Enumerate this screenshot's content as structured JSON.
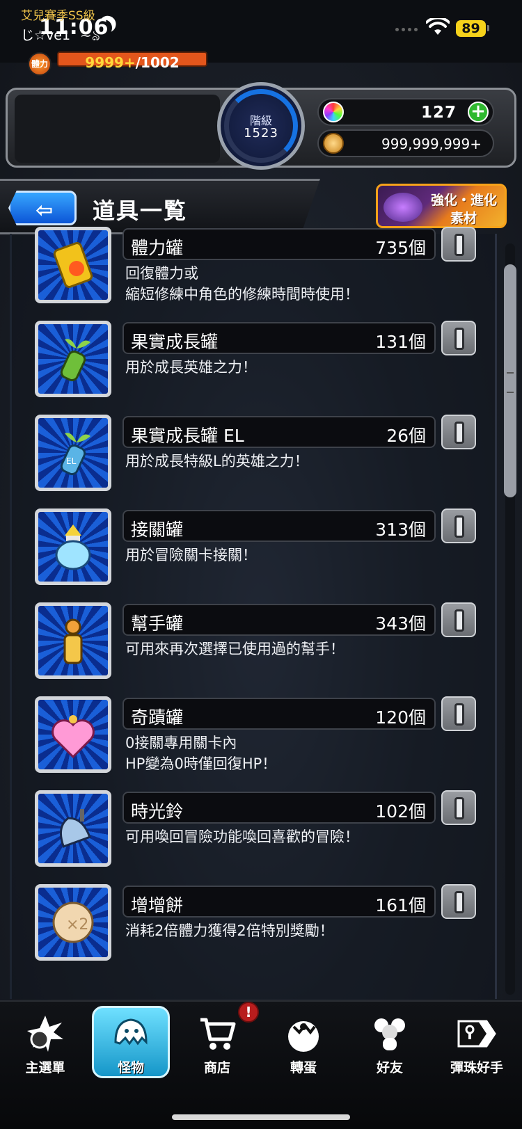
{
  "status_bar": {
    "time": "11:06",
    "battery": "89"
  },
  "player": {
    "season": "艾兒賽季SS級",
    "name": "じ☆ve1",
    "stamina_label": "體力",
    "stamina_current": "9999+",
    "stamina_max": "/1002",
    "rank_label": "階級",
    "rank_value": "1523",
    "orbs": "127",
    "gold": "999,999,999+"
  },
  "title_bar": {
    "title": "道具一覧",
    "upgrade_line1": "強化・進化",
    "upgrade_line2": "素材"
  },
  "items": [
    {
      "name": "體力罐",
      "count": "735個",
      "desc": [
        "回復體力或",
        "縮短修練中角色的修練時間時使用！"
      ],
      "icon": "stamina-can-icon"
    },
    {
      "name": "果實成長罐",
      "count": "131個",
      "desc": [
        "用於成長英雄之力！"
      ],
      "icon": "fruit-growth-can-icon"
    },
    {
      "name": "果實成長罐 EL",
      "count": "26個",
      "desc": [
        "用於成長特級L的英雄之力！"
      ],
      "icon": "fruit-growth-can-el-icon"
    },
    {
      "name": "接關罐",
      "count": "313個",
      "desc": [
        "用於冒險關卡接關！"
      ],
      "icon": "continue-can-icon"
    },
    {
      "name": "幫手罐",
      "count": "343個",
      "desc": [
        "可用來再次選擇已使用過的幫手！"
      ],
      "icon": "helper-can-icon"
    },
    {
      "name": "奇蹟罐",
      "count": "120個",
      "desc": [
        "0接關專用關卡內",
        "HP變為0時僅回復HP！"
      ],
      "icon": "miracle-can-icon"
    },
    {
      "name": "時光鈴",
      "count": "102個",
      "desc": [
        "可用喚回冒險功能喚回喜歡的冒險！"
      ],
      "icon": "time-bell-icon"
    },
    {
      "name": "增增餅",
      "count": "161個",
      "desc": [
        "消耗2倍體力獲得2倍特別獎勵！"
      ],
      "icon": "double-cookie-icon"
    }
  ],
  "nav": [
    {
      "label": "主選單",
      "icon": "main-menu-icon"
    },
    {
      "label": "怪物",
      "icon": "monster-icon"
    },
    {
      "label": "商店",
      "icon": "cart-icon"
    },
    {
      "label": "轉蛋",
      "icon": "gacha-egg-icon"
    },
    {
      "label": "好友",
      "icon": "friends-icon"
    },
    {
      "label": "彈珠好手",
      "icon": "pinball-ace-icon"
    }
  ],
  "nav_alert": "!",
  "colors": {
    "accent_blue": "#1672e3",
    "stamina_orange": "#e3561c",
    "gold_text": "#f0c44a"
  }
}
